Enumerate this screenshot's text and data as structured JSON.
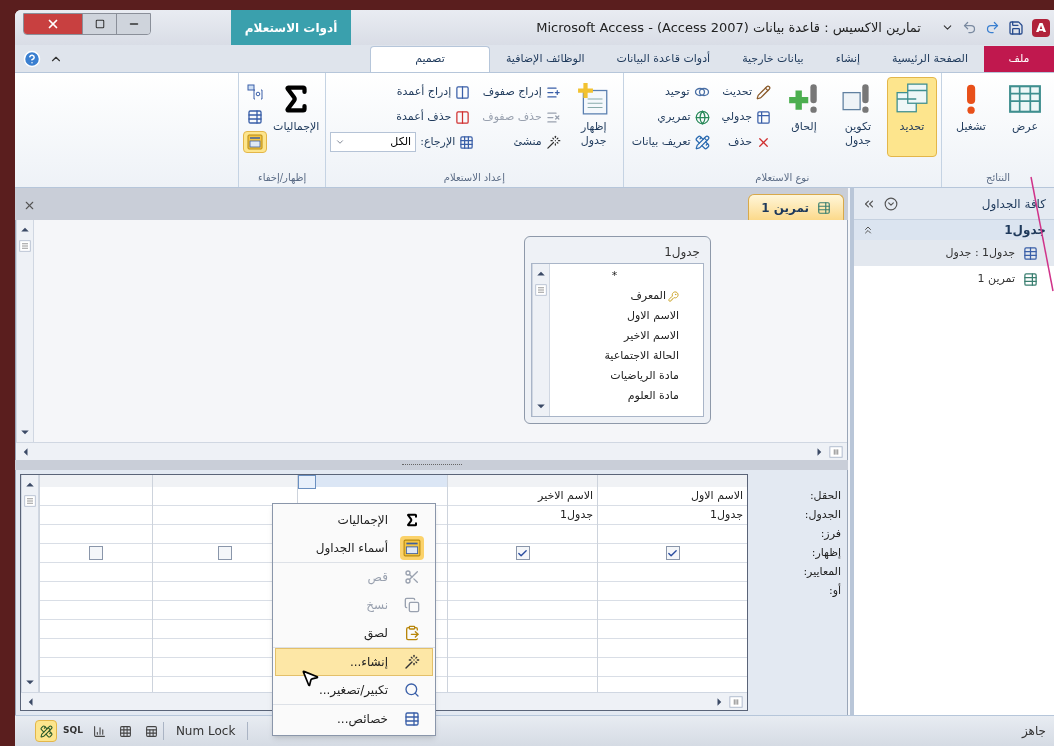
{
  "window": {
    "app_letter": "A",
    "title": "تمارين الاكسيس : قاعدة بيانات (Access 2007) - Microsoft Access",
    "context_group": "أدوات الاستعلام"
  },
  "tabs": [
    {
      "label": "ملف",
      "kind": "file",
      "selected": false
    },
    {
      "label": "الصفحة الرئيسية",
      "kind": "tab",
      "selected": false
    },
    {
      "label": "إنشاء",
      "kind": "tab",
      "selected": false
    },
    {
      "label": "بيانات خارجية",
      "kind": "tab",
      "selected": false
    },
    {
      "label": "أدوات قاعدة البيانات",
      "kind": "tab",
      "selected": false
    },
    {
      "label": "الوظائف الإضافية",
      "kind": "tab",
      "selected": false
    },
    {
      "label": "تصميم",
      "kind": "tab",
      "selected": true
    }
  ],
  "ribbon": [
    {
      "label": "النتائج",
      "items": [
        {
          "kind": "large",
          "label": "عرض",
          "selected": false
        },
        {
          "kind": "large",
          "label": "تشغيل",
          "selected": false
        }
      ]
    },
    {
      "label": "نوع الاستعلام",
      "items": [
        {
          "kind": "large",
          "label": "تحديد",
          "selected": true
        },
        {
          "kind": "large",
          "label": "تكوين جدول",
          "selected": false
        },
        {
          "kind": "large",
          "label": "إلحاق",
          "selected": false
        },
        {
          "kind": "small",
          "label": "تحديث",
          "selected": false
        },
        {
          "kind": "small",
          "label": "جدولي",
          "selected": false
        },
        {
          "kind": "small",
          "label": "حذف",
          "selected": false
        },
        {
          "kind": "small",
          "label": "توحيد",
          "selected": false
        },
        {
          "kind": "small",
          "label": "تمريري",
          "selected": false
        },
        {
          "kind": "small",
          "label": "تعريف بيانات",
          "selected": false
        }
      ]
    },
    {
      "label": "إعداد الاستعلام",
      "items": [
        {
          "kind": "large",
          "label": "إظهار جدول",
          "disabled": false
        },
        {
          "kind": "small",
          "label": "إدراج صفوف",
          "disabled": false
        },
        {
          "kind": "small",
          "label": "حذف صفوف",
          "disabled": true
        },
        {
          "kind": "small",
          "label": "منشئ",
          "disabled": false
        },
        {
          "kind": "small",
          "label": "إدراج أعمدة",
          "disabled": false
        },
        {
          "kind": "small",
          "label": "حذف أعمدة",
          "disabled": false
        },
        {
          "kind": "combo",
          "label": "الإرجاع:",
          "value": "الكل"
        }
      ]
    },
    {
      "label": "إظهار/إخفاء",
      "items": [
        {
          "kind": "large",
          "label": "الإجماليات",
          "selected": false
        },
        {
          "kind": "toggle",
          "selected": false
        },
        {
          "kind": "toggle",
          "selected": false
        },
        {
          "kind": "toggle",
          "selected": true
        }
      ]
    }
  ],
  "nav_pane": {
    "title": "كافة الجداول",
    "groups": [
      {
        "label": "جدول1",
        "expanded": true,
        "items": [
          {
            "label": "جدول1 : جدول",
            "kind": "table",
            "selected": true
          },
          {
            "label": "تمرين 1",
            "kind": "query",
            "selected": false
          }
        ]
      }
    ]
  },
  "document": {
    "tab": {
      "label": "تمرين 1",
      "selected": true
    },
    "field_list": {
      "title": "جدول1",
      "fields": [
        {
          "label": "*",
          "primary_key": false
        },
        {
          "label": "المعرف",
          "primary_key": true
        },
        {
          "label": "الاسم الاول",
          "primary_key": false
        },
        {
          "label": "الاسم الاخير",
          "primary_key": false
        },
        {
          "label": "الحالة الاجتماعية",
          "primary_key": false
        },
        {
          "label": "مادة الرياضيات",
          "primary_key": false
        },
        {
          "label": "مادة العلوم",
          "primary_key": false
        }
      ]
    },
    "grid": {
      "row_labels": [
        "الحقل:",
        "الجدول:",
        "فرز:",
        "إظهار:",
        "المعايير:",
        "أو:"
      ],
      "columns": [
        {
          "field": "الاسم الاول",
          "table": "جدول1",
          "show": true,
          "selected": false
        },
        {
          "field": "الاسم الاخير",
          "table": "جدول1",
          "show": true,
          "selected": false
        },
        {
          "selected": true
        },
        {
          "show": false,
          "selected": false
        },
        {
          "show": false,
          "selected": false
        }
      ]
    }
  },
  "context_menu": [
    {
      "label": "الإجماليات",
      "disabled": false,
      "highlighted": false,
      "toggled": false,
      "group_end": false
    },
    {
      "label": "أسماء الجداول",
      "disabled": false,
      "highlighted": false,
      "toggled": true,
      "group_end": true
    },
    {
      "label": "قص",
      "disabled": true,
      "highlighted": false,
      "toggled": false,
      "group_end": false
    },
    {
      "label": "نسخ",
      "disabled": true,
      "highlighted": false,
      "toggled": false,
      "group_end": false
    },
    {
      "label": "لصق",
      "disabled": false,
      "highlighted": false,
      "toggled": false,
      "group_end": true
    },
    {
      "label": "إنشاء...",
      "disabled": false,
      "highlighted": true,
      "toggled": false,
      "group_end": false
    },
    {
      "label": "تكبير/تصغير...",
      "disabled": false,
      "highlighted": false,
      "toggled": false,
      "group_end": true
    },
    {
      "label": "خصائص...",
      "disabled": false,
      "highlighted": false,
      "toggled": false,
      "group_end": false
    }
  ],
  "status_bar": {
    "text": "جاهز",
    "indicator": "Num Lock",
    "views": [
      {
        "kind": "design",
        "selected": true
      },
      {
        "kind": "sql",
        "label": "SQL",
        "selected": false
      },
      {
        "kind": "pivot_chart",
        "selected": false
      },
      {
        "kind": "pivot_table",
        "selected": false
      },
      {
        "kind": "datasheet",
        "selected": false
      }
    ]
  }
}
